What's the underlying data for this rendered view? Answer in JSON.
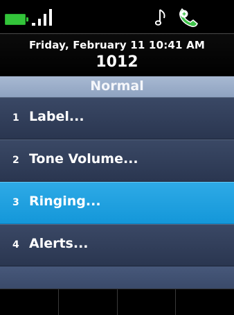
{
  "status": {
    "battery_color": "#33c43a",
    "icons": [
      "battery-icon",
      "signal-strength-icon",
      "music-note-icon",
      "handset-icon"
    ]
  },
  "header": {
    "date_time": "Friday, February 11 10:41 AM",
    "extension": "1012"
  },
  "title": "Normal",
  "menu": [
    {
      "number": "1",
      "label": "Label..."
    },
    {
      "number": "2",
      "label": "Tone Volume..."
    },
    {
      "number": "3",
      "label": "Ringing...",
      "selected": true
    },
    {
      "number": "4",
      "label": "Alerts..."
    }
  ],
  "softkeys": [
    "",
    "",
    "",
    ""
  ],
  "colors": {
    "selected": "#1ea0e0",
    "menu_bg": "#323f5b",
    "title_bg": "#9aaecb"
  }
}
